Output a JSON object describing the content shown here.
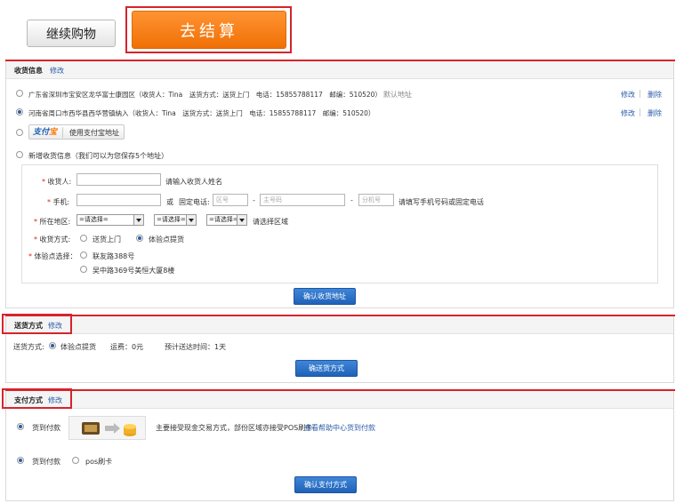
{
  "top": {
    "continue_label": "继续购物",
    "checkout_label": "去结算"
  },
  "shipping_info": {
    "title": "收货信息",
    "edit_label": "修改",
    "addresses": [
      {
        "text": "广东省深圳市宝安区龙华富士康园区（收货人：Tina　送货方式：送货上门　电话：15855788117　邮编：510520）",
        "default_label": "默认地址",
        "selected": false,
        "edit_label": "修改",
        "delete_label": "删除"
      },
      {
        "text": "河南省周口市西华县西华营镇納入（收货人：Tina　送货方式：送货上门　电话：15855788117　邮编：510520）",
        "selected": true,
        "edit_label": "修改",
        "delete_label": "删除"
      }
    ],
    "alipay_logo_a": "支付",
    "alipay_logo_b": "宝",
    "alipay_label": "使用支付宝地址",
    "new_address_label": "新增收货信息（我们可以为您保存5个地址）",
    "form": {
      "receiver_label": "收货人:",
      "receiver_hint": "请输入收货人姓名",
      "mobile_label": "手机:",
      "or_label": "或",
      "phone_label": "固定电话:",
      "area_code_ph": "区号",
      "main_number_ph": "主号码",
      "dash": "-",
      "extension_ph": "分机号",
      "phone_hint": "请填写手机号码或固定电话",
      "region_label": "所在地区:",
      "select_value": "=请选择=",
      "region_hint": "请选择区域",
      "delivery_label": "收货方式:",
      "delivery_options": [
        "送货上门",
        "体验点提货"
      ],
      "pickup_label": "体验点选择：",
      "pickup_options": [
        "联友路388号",
        "吴中路369号美恒大厦8楼"
      ]
    },
    "confirm_label": "确认收货地址"
  },
  "delivery": {
    "title": "送货方式",
    "edit_label": "修改",
    "method_label": "送货方式:",
    "method_value": "体验点提货",
    "fee_label": "运费：0元",
    "eta_label": "预计送达时间：1天",
    "confirm_label": "确送货方式"
  },
  "payment": {
    "title": "支付方式",
    "edit_label": "修改",
    "cod_label": "货到付款",
    "cod_desc": "主要接受现金交易方式，部份区域亦接受POS刷卡",
    "help_link": "查看帮助中心货到付款",
    "option_cod": "货到付款",
    "option_pos": "pos刷卡",
    "confirm_label": "确认支付方式"
  },
  "colors": {
    "accent_orange": "#f07006",
    "highlight_red": "#d6242c",
    "link_blue": "#2a5caa",
    "button_blue": "#1f62b8"
  }
}
